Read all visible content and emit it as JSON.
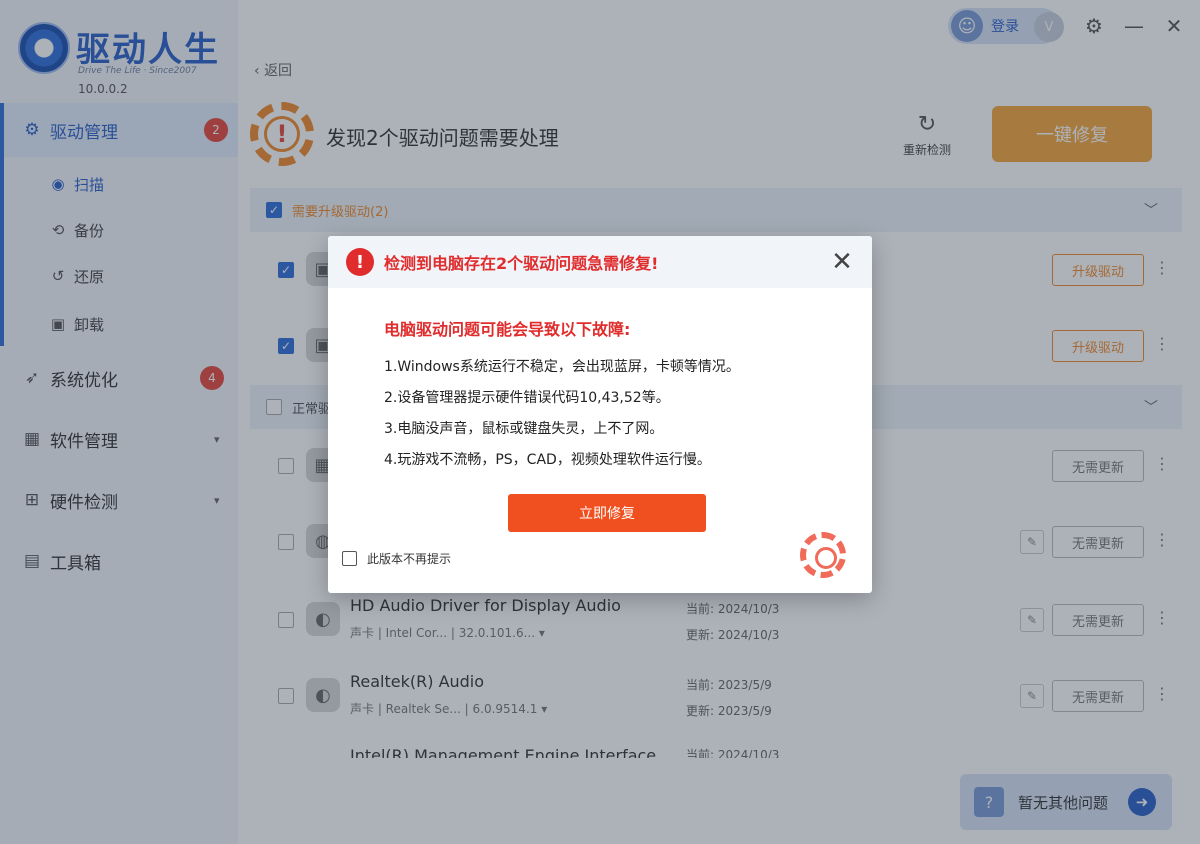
{
  "app": {
    "title": "驱动人生",
    "subtitle": "Drive The Life · Since2007",
    "version": "10.0.0.2"
  },
  "topbar": {
    "login_label": "登录",
    "vip_label": "V"
  },
  "sidebar": {
    "items": [
      {
        "label": "驱动管理",
        "badge": "2"
      },
      {
        "label": "系统优化",
        "badge": "4"
      },
      {
        "label": "软件管理"
      },
      {
        "label": "硬件检测"
      },
      {
        "label": "工具箱"
      }
    ],
    "sub_items": [
      {
        "label": "扫描"
      },
      {
        "label": "备份"
      },
      {
        "label": "还原"
      },
      {
        "label": "卸载"
      }
    ]
  },
  "main": {
    "back_label": "返回",
    "headline": "发现2个驱动问题需要处理",
    "rescan_label": "重新检测",
    "fix_all_label": "一键修复",
    "section_upgrade": "需要升级驱动(2)",
    "section_normal": "正常驱动",
    "upgrade_button": "升级驱动",
    "no_update_button": "无需更新",
    "current_prefix": "当前:",
    "update_prefix": "更新:",
    "devices": [
      {
        "name": "HD Audio Driver for Display Audio",
        "meta": "声卡 | Intel Cor... | 32.0.101.6... ▾",
        "current": "2024/10/3",
        "update": "2024/10/3"
      },
      {
        "name": "Realtek(R) Audio",
        "meta": "声卡 | Realtek Se... | 6.0.9514.1 ▾",
        "current": "2023/5/9",
        "update": "2023/5/9"
      },
      {
        "name": "Intel(R) Management Engine Interface",
        "current": "2024/10/3"
      }
    ],
    "footer_label": "暂无其他问题"
  },
  "modal": {
    "title": "检测到电脑存在2个驱动问题急需修复!",
    "subtitle": "电脑驱动问题可能会导致以下故障:",
    "items": [
      "1.Windows系统运行不稳定，会出现蓝屏，卡顿等情况。",
      "2.设备管理器提示硬件错误代码10,43,52等。",
      "3.电脑没声音，鼠标或键盘失灵，上不了网。",
      "4.玩游戏不流畅，PS，CAD，视频处理软件运行慢。"
    ],
    "fix_now_label": "立即修复",
    "dont_show_label": "此版本不再提示"
  },
  "icons": {
    "gear": "gear-icon",
    "scan": "scan-icon",
    "backup": "backup-icon",
    "restore": "restore-icon",
    "uninstall": "uninstall-icon",
    "rocket": "rocket-icon",
    "apps": "apps-icon",
    "hardware": "hardware-icon",
    "toolbox": "toolbox-icon",
    "close": "close-icon",
    "alert": "alert-icon"
  },
  "colors": {
    "brand_blue": "#2a5fc8",
    "accent_orange": "#f6a63a",
    "alert_red": "#e02c2c",
    "fix_button": "#f0501f"
  }
}
